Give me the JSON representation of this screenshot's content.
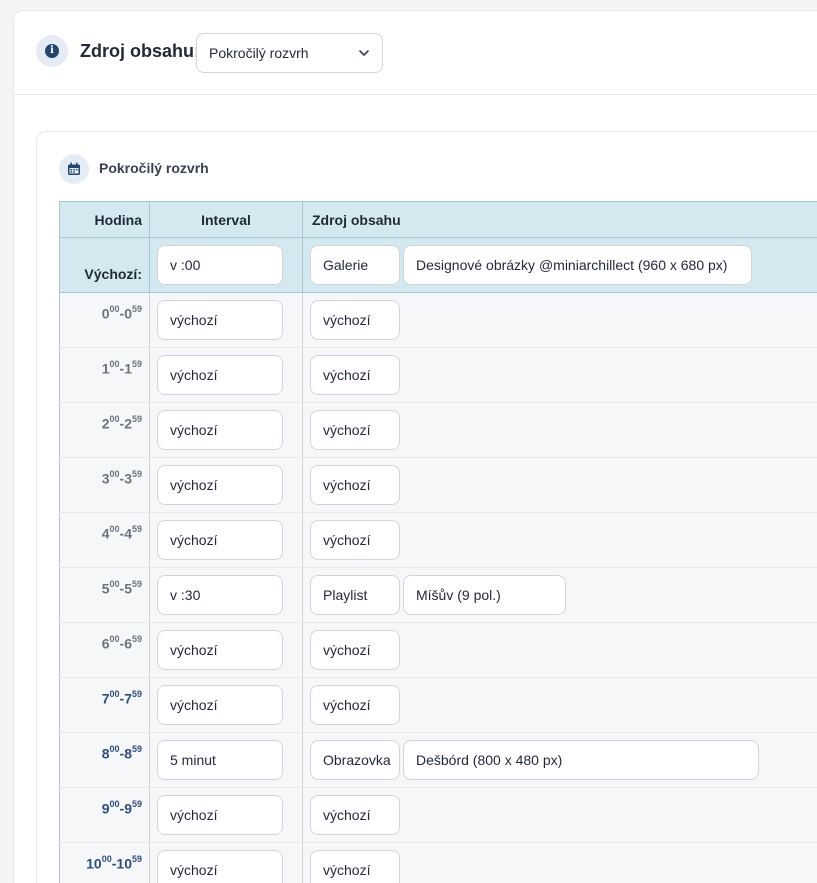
{
  "header": {
    "label": "Zdroj obsahu:",
    "selected": "Pokročilý rozvrh"
  },
  "section": {
    "title": "Pokročilý rozvrh"
  },
  "table": {
    "col_hour": "Hodina",
    "col_interval": "Interval",
    "col_source": "Zdroj obsahu",
    "default_label": "Výchozí:",
    "default_interval": "v :00",
    "default_source": "Galerie",
    "default_detail": "Designové obrázky @miniarchillect (960 x 680 px)",
    "rows": [
      {
        "h": "0",
        "interval": "výchozí",
        "source": "výchozí",
        "detail": ""
      },
      {
        "h": "1",
        "interval": "výchozí",
        "source": "výchozí",
        "detail": ""
      },
      {
        "h": "2",
        "interval": "výchozí",
        "source": "výchozí",
        "detail": ""
      },
      {
        "h": "3",
        "interval": "výchozí",
        "source": "výchozí",
        "detail": ""
      },
      {
        "h": "4",
        "interval": "výchozí",
        "source": "výchozí",
        "detail": ""
      },
      {
        "h": "5",
        "interval": "v :30",
        "source": "Playlist",
        "detail": "Míšův (9 pol.)"
      },
      {
        "h": "6",
        "interval": "výchozí",
        "source": "výchozí",
        "detail": ""
      },
      {
        "h": "7",
        "interval": "výchozí",
        "source": "výchozí",
        "detail": ""
      },
      {
        "h": "8",
        "interval": "5 minut",
        "source": "Obrazovka",
        "detail": "Dešbórd (800 x 480 px)"
      },
      {
        "h": "9",
        "interval": "výchozí",
        "source": "výchozí",
        "detail": ""
      },
      {
        "h": "10",
        "interval": "výchozí",
        "source": "výchozí",
        "detail": ""
      }
    ],
    "hour_start_suffix": "00",
    "hour_end_suffix": "59"
  },
  "colors": {
    "accent": "#24466e",
    "header_row_bg": "#d4e8ef",
    "row_bg": "#f6f7f8"
  },
  "icons": {
    "header": "info-icon",
    "section": "calendar-icon",
    "select": "chevron-down-icon"
  }
}
